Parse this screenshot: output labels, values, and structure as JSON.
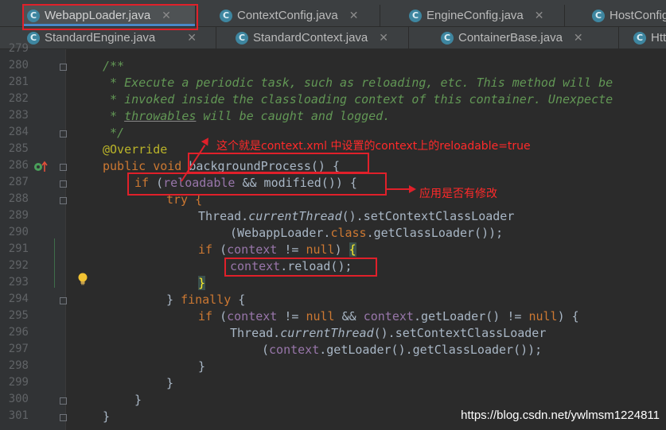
{
  "tabs_row1": [
    {
      "name": "WebappLoader.java",
      "active": true,
      "closable": true
    },
    {
      "name": "ContextConfig.java",
      "closable": true
    },
    {
      "name": "EngineConfig.java",
      "closable": true
    },
    {
      "name": "HostConfig",
      "closable": false
    }
  ],
  "tabs_row2": [
    {
      "name": "StandardEngine.java",
      "closable": true
    },
    {
      "name": "StandardContext.java",
      "closable": true
    },
    {
      "name": "ContainerBase.java",
      "closable": true
    },
    {
      "name": "Htt",
      "closable": false
    }
  ],
  "editor": {
    "line_numbers": [
      "279",
      "280",
      "281",
      "282",
      "283",
      "284",
      "285",
      "286",
      "287",
      "288",
      "289",
      "290",
      "291",
      "292",
      "293",
      "294",
      "295",
      "296",
      "297",
      "298",
      "299",
      "300",
      "301"
    ],
    "code": {
      "l280": "/**",
      "l281": " * Execute a periodic task, such as reloading, etc. This method will be",
      "l282": " * invoked inside the classloading context of this container. Unexpecte",
      "l283_a": " * ",
      "l283_b": "throwables",
      "l283_c": " will be caught and logged.",
      "l284": " */",
      "l285": "@Override",
      "l286_kw": "public void ",
      "l286_fn": "backgroundProcess() {",
      "l287_kw": "if ",
      "l287_p": "(",
      "l287_f": "reloadable",
      "l287_r": " && modified()) {",
      "l288": "try {",
      "l289_a": "Thread.",
      "l289_b": "currentThread",
      "l289_c": "().setContextClassLoader",
      "l290_a": "(WebappLoader.",
      "l290_b": "class",
      "l290_c": ".getClassLoader());",
      "l291_kw": "if ",
      "l291_a": "(",
      "l291_f": "context",
      "l291_b": " != ",
      "l291_n": "null",
      "l291_c": ") ",
      "l291_br": "{",
      "l292_f": "context",
      "l292_r": ".reload();",
      "l293_br": "}",
      "l294_a": "} ",
      "l294_kw": "finally",
      "l294_b": " {",
      "l295_kw": "if ",
      "l295_a": "(",
      "l295_f1": "context",
      "l295_b": " != ",
      "l295_n1": "null",
      "l295_c": " && ",
      "l295_f2": "context",
      "l295_d": ".getLoader() != ",
      "l295_n2": "null",
      "l295_e": ") {",
      "l296_a": "Thread.",
      "l296_b": "currentThread",
      "l296_c": "().setContextClassLoader",
      "l297_a": "(",
      "l297_f": "context",
      "l297_b": ".getLoader().getClassLoader());",
      "l298": "}",
      "l299": "}",
      "l300": "}",
      "l301": "}"
    }
  },
  "annotations": {
    "note1": "这个就是context.xml 中设置的context上的reloadable=true",
    "note2": "应用是否有修改"
  },
  "watermark": "https://blog.csdn.net/ywlmsm1224811",
  "colors": {
    "background": "#2b2b2b",
    "comment": "#629755",
    "keyword": "#cc7832",
    "field": "#9876aa",
    "annotation": "#bbb529",
    "text": "#a9b7c6",
    "annotation_red": "#e0202a"
  }
}
